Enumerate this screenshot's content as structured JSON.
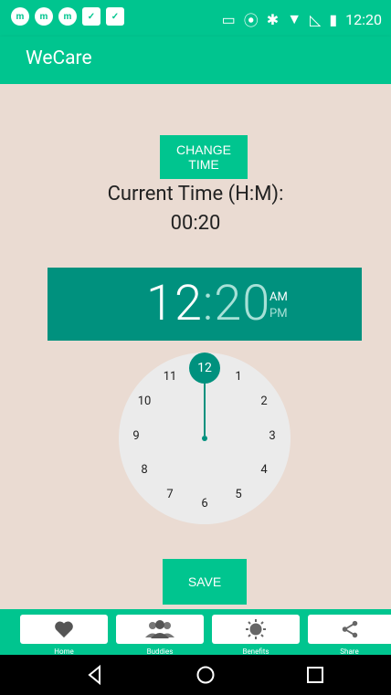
{
  "status": {
    "time": "12:20"
  },
  "app": {
    "title": "WeCare"
  },
  "main": {
    "change_button": "CHANGE TIME",
    "current_label": "Current Time (H:M):",
    "current_value": "00:20",
    "picker": {
      "hour": "12",
      "separator": ":",
      "minute": "20",
      "am": "AM",
      "pm": "PM",
      "selected_hour": "12"
    },
    "clock_numbers": [
      "12",
      "1",
      "2",
      "3",
      "4",
      "5",
      "6",
      "7",
      "8",
      "9",
      "10",
      "11"
    ],
    "save_button": "SAVE"
  },
  "tabs": [
    {
      "label": "Home",
      "icon": "heart-icon"
    },
    {
      "label": "Buddies",
      "icon": "buddies-icon"
    },
    {
      "label": "Benefits",
      "icon": "sun-icon"
    },
    {
      "label": "Share",
      "icon": "share-icon"
    }
  ],
  "colors": {
    "primary": "#00c58f",
    "dark_teal": "#00917e",
    "background": "#eadbd2"
  }
}
